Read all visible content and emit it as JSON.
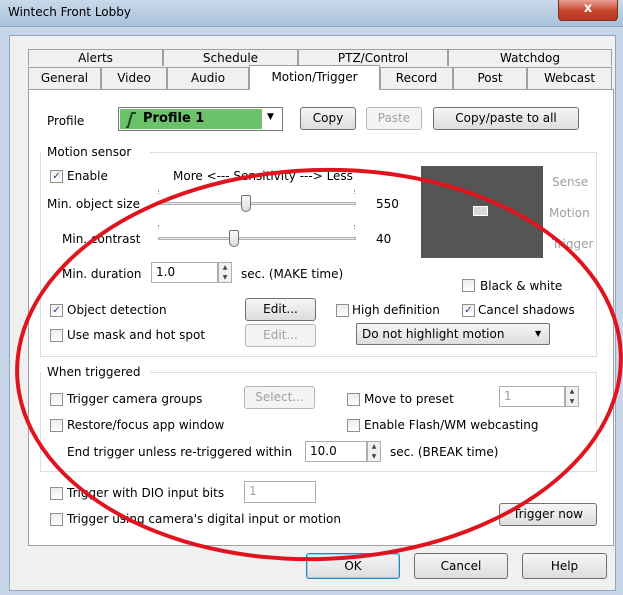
{
  "window": {
    "title": "Wintech Front Lobby",
    "close_glyph": "x"
  },
  "tabs_row1": [
    "Alerts",
    "Schedule",
    "PTZ/Control",
    "Watchdog"
  ],
  "tabs_row2": [
    "General",
    "Video",
    "Audio",
    "Motion/Trigger",
    "Record",
    "Post",
    "Webcast"
  ],
  "active_tab": "Motion/Trigger",
  "profile": {
    "label": "Profile",
    "value": "Profile 1",
    "color": "#6cc26a",
    "copy": "Copy",
    "paste": "Paste",
    "copy_all": "Copy/paste to all"
  },
  "motion": {
    "title": "Motion sensor",
    "enable_label": "Enable",
    "enable_checked": true,
    "sensitivity_label": "More <--- Sensitivity ---> Less",
    "min_object_label": "Min. object size",
    "min_object_value": "550",
    "min_object_fraction": 0.44,
    "min_contrast_label": "Min. contrast",
    "min_contrast_value": "40",
    "min_contrast_fraction": 0.38,
    "min_duration_label": "Min. duration",
    "min_duration_value": "1.0",
    "min_duration_unit": "sec. (MAKE time)",
    "sense_label": "Sense",
    "motion_label": "Motion",
    "trigger_label": "Trigger",
    "bw_label": "Black & white",
    "bw_checked": false,
    "object_detection_label": "Object detection",
    "object_detection_checked": true,
    "edit_label": "Edit...",
    "high_def_label": "High definition",
    "high_def_checked": false,
    "cancel_shadows_label": "Cancel shadows",
    "cancel_shadows_checked": true,
    "mask_label": "Use mask and hot spot",
    "mask_checked": false,
    "edit2_label": "Edit...",
    "highlight_value": "Do not highlight motion"
  },
  "triggered": {
    "title": "When triggered",
    "camera_groups_label": "Trigger camera groups",
    "select_label": "Select...",
    "move_preset_label": "Move to preset",
    "preset_value": "1",
    "restore_label": "Restore/focus app window",
    "flash_label": "Enable Flash/WM webcasting",
    "end_trigger_label": "End trigger unless re-triggered within",
    "end_trigger_value": "10.0",
    "end_trigger_unit": "sec. (BREAK time)"
  },
  "dio": {
    "dio_label": "Trigger with DIO input bits",
    "dio_value": "1",
    "camera_input_label": "Trigger using camera's digital input or motion",
    "trigger_now": "Trigger now"
  },
  "footer": {
    "ok": "OK",
    "cancel": "Cancel",
    "help": "Help"
  },
  "check_glyph": "✓",
  "dropdown_glyph": "▼"
}
